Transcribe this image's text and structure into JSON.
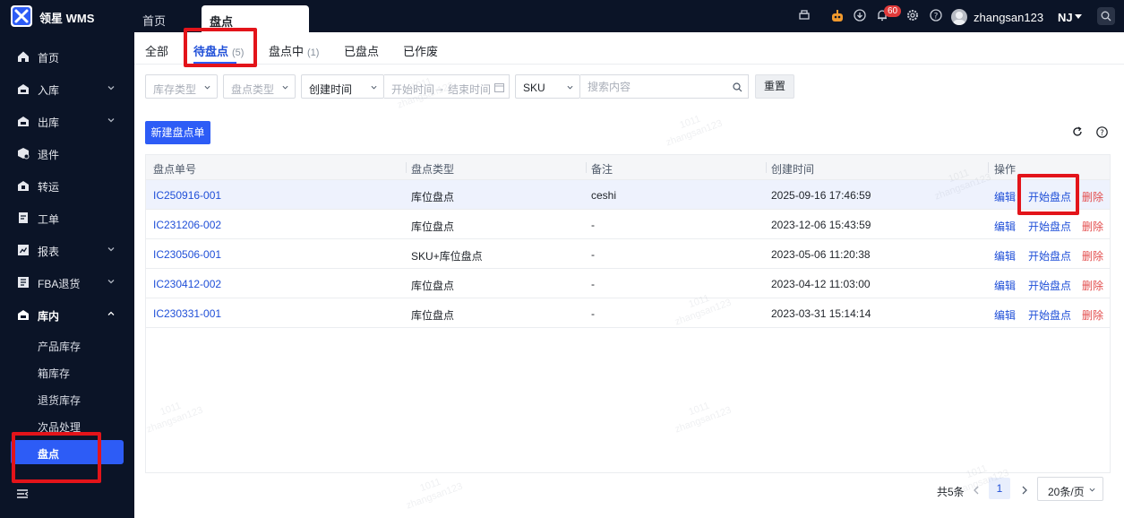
{
  "app": {
    "brand": "领星 WMS"
  },
  "top_tabs": [
    {
      "label": "首页"
    },
    {
      "label": "盘点"
    }
  ],
  "header": {
    "notification_count": "60",
    "username": "zhangsan123",
    "region": "NJ"
  },
  "sidebar": {
    "items": [
      {
        "label": "首页"
      },
      {
        "label": "入库"
      },
      {
        "label": "出库"
      },
      {
        "label": "退件"
      },
      {
        "label": "转运"
      },
      {
        "label": "工单"
      },
      {
        "label": "报表"
      },
      {
        "label": "FBA退货"
      },
      {
        "label": "库内"
      }
    ],
    "sub_items": [
      {
        "label": "产品库存"
      },
      {
        "label": "箱库存"
      },
      {
        "label": "退货库存"
      },
      {
        "label": "次品处理"
      },
      {
        "label": "盘点"
      }
    ]
  },
  "tabs": [
    {
      "label": "全部",
      "count": ""
    },
    {
      "label": "待盘点",
      "count": "(5)"
    },
    {
      "label": "盘点中",
      "count": "(1)"
    },
    {
      "label": "已盘点",
      "count": ""
    },
    {
      "label": "已作废",
      "count": ""
    }
  ],
  "filters": {
    "stock_type": "库存类型",
    "count_type": "盘点类型",
    "time_type": "创建时间",
    "start_time": "开始时间",
    "end_time": "结束时间",
    "search_field": "SKU",
    "search_placeholder": "搜索内容",
    "reset": "重置"
  },
  "toolbar": {
    "new_label": "新建盘点单"
  },
  "table": {
    "columns": [
      "盘点单号",
      "盘点类型",
      "备注",
      "创建时间",
      "操作"
    ],
    "actions": {
      "edit": "编辑",
      "start": "开始盘点",
      "delete": "删除"
    },
    "rows": [
      {
        "id": "IC250916-001",
        "type": "库位盘点",
        "note": "ceshi",
        "created": "2025-09-16 17:46:59"
      },
      {
        "id": "IC231206-002",
        "type": "库位盘点",
        "note": "-",
        "created": "2023-12-06 15:43:59"
      },
      {
        "id": "IC230506-001",
        "type": "SKU+库位盘点",
        "note": "-",
        "created": "2023-05-06 11:20:38"
      },
      {
        "id": "IC230412-002",
        "type": "库位盘点",
        "note": "-",
        "created": "2023-04-12 11:03:00"
      },
      {
        "id": "IC230331-001",
        "type": "库位盘点",
        "note": "-",
        "created": "2023-03-31 15:14:14"
      }
    ]
  },
  "pagination": {
    "total": "共5条",
    "page": "1",
    "page_size": "20条/页"
  },
  "watermark": {
    "line1": "1011",
    "line2": "zhangsan123"
  },
  "colors": {
    "primary": "#2d5cf6",
    "link": "#1f4fd8",
    "danger": "#e34d4d",
    "sidebar_bg": "#0b1427",
    "annotation": "#e3141a"
  }
}
